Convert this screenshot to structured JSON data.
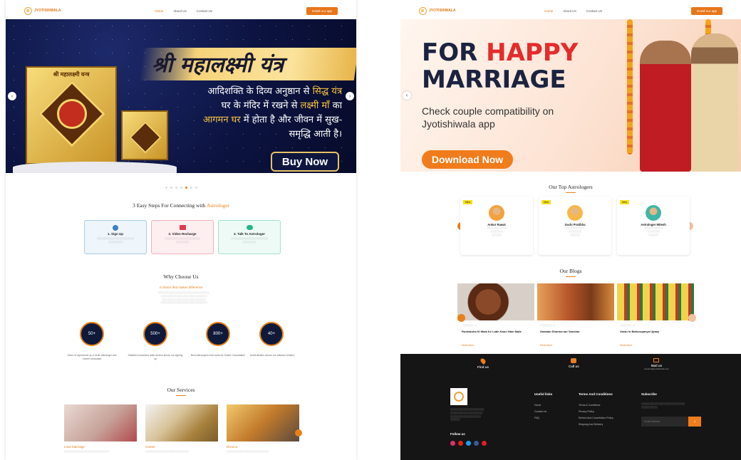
{
  "left": {
    "nav": {
      "brand": "JYOTISHIWALA",
      "links": [
        "Home",
        "About Us",
        "Contact Us"
      ],
      "cta": "Install our app"
    },
    "hero": {
      "title": "श्री महालक्ष्मी यंत्र",
      "line1_a": "आदिशक्ति के दिव्य अनुष्ठान से ",
      "line1_b": "सिद्ध यंत्र",
      "line2_a": "घर के मंदिर में रखने से ",
      "line2_b": "लक्ष्मी माँ",
      "line2_c": " का",
      "line3_a": "आगमन घर",
      "line3_b": " में होता है और जीवन में सुख-",
      "line4": "समृद्धि आती है।",
      "product_label": "श्री महालक्ष्मी यन्त्र",
      "buy": "Buy Now"
    },
    "steps": {
      "title": "3 Easy Steps For Connecting with ",
      "title_highlight": "Astrologer",
      "items": [
        {
          "label": "1. Sign Up",
          "bg": "#eef5fb",
          "border": "#a9cbe6",
          "icon_color": "#3b82c4"
        },
        {
          "label": "2. Video Recharge",
          "bg": "#fdeef0",
          "border": "#f0b3bb",
          "icon_color": "#e0394e"
        },
        {
          "label": "3. Talk To Astrologer",
          "bg": "#edfaf6",
          "border": "#a4e0cc",
          "icon_color": "#23b48a"
        }
      ]
    },
    "why": {
      "title": "Why Choose Us",
      "subtitle": "4 choice that makes difference",
      "stats": [
        {
          "value": "50+",
          "caption": "Years of experience as a Vedic astrologer and Career consultant"
        },
        {
          "value": "500+",
          "caption": "Satisfied customers daily service above our signing up"
        },
        {
          "value": "800+",
          "caption": "Best Astrologers from India for Online Consultation"
        },
        {
          "value": "40+",
          "caption": "Authenticities across our reliance verifiers"
        }
      ]
    },
    "services": {
      "title": "Our Services",
      "items": [
        {
          "label": "Love Marriage"
        },
        {
          "label": "Career"
        },
        {
          "label": "Divorce"
        }
      ]
    }
  },
  "right": {
    "nav": {
      "brand": "JYOTISHIWALA",
      "links": [
        "Home",
        "About Us",
        "Contact Us"
      ],
      "cta": "Install our app"
    },
    "hero": {
      "line1_a": "FOR ",
      "line1_b": "HAPPY",
      "line2": "MARRIAGE",
      "sub1": "Check couple compatibility on",
      "sub2": "Jyotishiwala app",
      "cta": "Download Now"
    },
    "astrologers": {
      "title": "Our Top Astrologers",
      "items": [
        {
          "name": "Ankur Rawat",
          "badge": "New"
        },
        {
          "name": "Sachi Pratibha",
          "badge": "New"
        },
        {
          "name": "Astrologer Mitesh",
          "badge": "New"
        }
      ]
    },
    "blogs": {
      "title": "Our Blogs",
      "items": [
        {
          "title": "Rudraksha Ki Mala Ke Labh Kaun Hain Mala",
          "meta": "Read More"
        },
        {
          "title": "Sanatan Dharma aur Sanskar",
          "meta": "Read More"
        },
        {
          "title": "Vastu in Bahurupanya Upaay",
          "meta": "Read More"
        }
      ]
    },
    "contact": [
      {
        "label": "Find us",
        "icon": "location-icon"
      },
      {
        "label": "Call us",
        "icon": "phone-icon"
      },
      {
        "label": "Mail us",
        "icon": "mail-icon",
        "detail": "support@jyotishiwala.com"
      }
    ],
    "footer": {
      "useful_title": "Useful links",
      "useful_links": [
        "Home",
        "Contact Us",
        "FAQ"
      ],
      "terms_title": "Terms And Conditions",
      "terms_links": [
        "Terms & Conditions",
        "Privacy Policy",
        "Refund And Cancellation Policy",
        "Shipping And Delivery"
      ],
      "subscribe_title": "Subscribe",
      "subscribe_placeholder": "Email Address",
      "follow": "Follow us"
    }
  }
}
